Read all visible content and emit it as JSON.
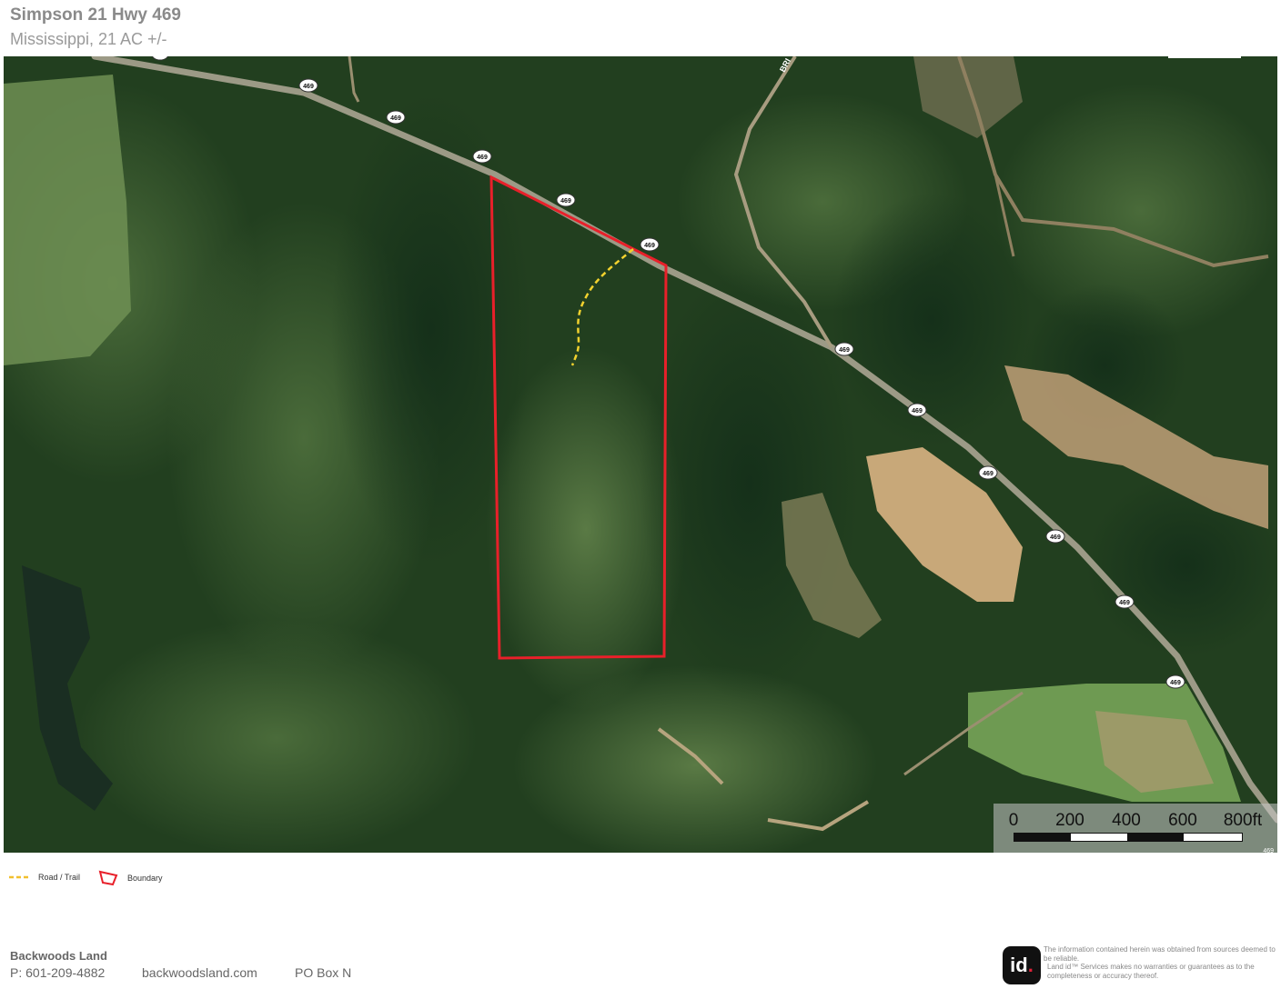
{
  "header": {
    "title": "Simpson 21 Hwy 469",
    "subtitle": "Mississippi, 21 AC +/-"
  },
  "map": {
    "road_label_top": "BRI",
    "route_shields": [
      "469",
      "469",
      "469",
      "469",
      "469",
      "469",
      "469",
      "469",
      "469",
      "469",
      "469",
      "469"
    ],
    "corner_shield": "469",
    "colors": {
      "boundary": "#e8202a",
      "trail": "#f2d22e",
      "forest_dark": "#1d3a1b",
      "forest_light": "#3f5f33",
      "clearing": "#c9a97a",
      "field": "#6e9a52",
      "highway": "#9c9a86"
    },
    "scale_bar": {
      "ticks": [
        "0",
        "200",
        "400",
        "600",
        "800ft"
      ]
    }
  },
  "legend": {
    "trail_label": "Road / Trail",
    "boundary_label": "Boundary",
    "trail_icon": "dashed-line-icon",
    "boundary_icon": "polygon-icon"
  },
  "footer": {
    "company": "Backwoods Land",
    "phone": "P: 601-209-4882",
    "website": "backwoodsland.com",
    "address": "PO Box N",
    "logo_text": "id",
    "logo_dot": ".",
    "disclaimer_1": "The information contained herein was obtained from sources deemed to be reliable.",
    "disclaimer_2": "Land id™ Services makes no warranties or guarantees as to the completeness or accuracy thereof."
  }
}
